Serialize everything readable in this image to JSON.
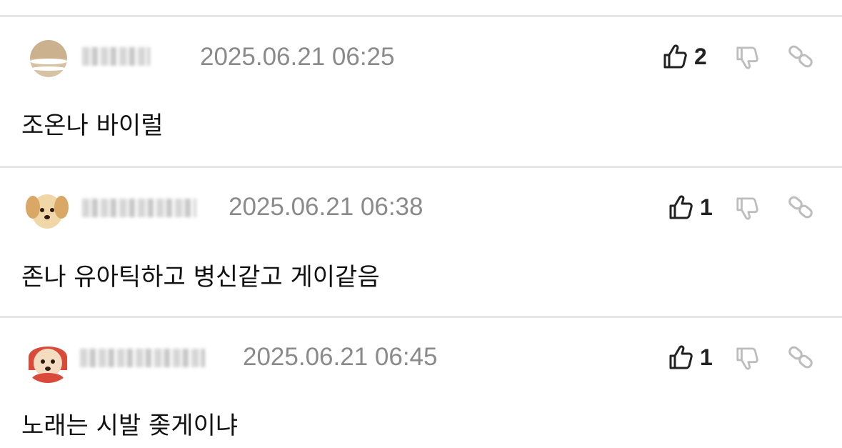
{
  "comments": [
    {
      "avatar": "globe-sand-icon",
      "timestamp": "2025.06.21 06:25",
      "likes": "2",
      "text": "조온나 바이럴"
    },
    {
      "avatar": "puppy-icon",
      "timestamp": "2025.06.21 06:38",
      "likes": "1",
      "text": "존나 유아틱하고 병신같고 게이같음"
    },
    {
      "avatar": "puppy-red-hood-icon",
      "timestamp": "2025.06.21 06:45",
      "likes": "1",
      "text": "노래는 시발 좆게이냐"
    }
  ],
  "colors": {
    "divider": "#e6e6e6",
    "timestamp": "#8a8a8a",
    "icon": "#222222",
    "icon_muted": "#bdbdbd"
  }
}
